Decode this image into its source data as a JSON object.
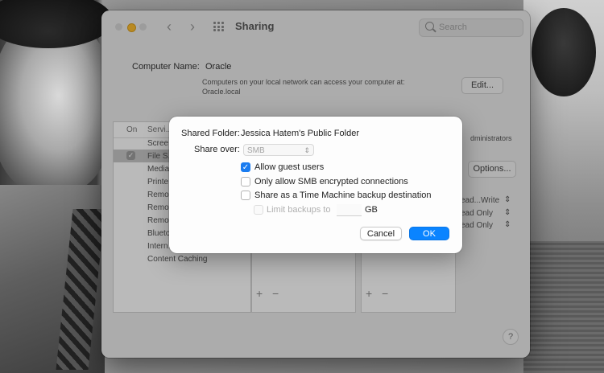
{
  "window": {
    "title": "Sharing",
    "search_placeholder": "Search"
  },
  "background_settings": {
    "computer_name_label": "Computer Name:",
    "computer_name": "Oracle",
    "network_note_line1": "Computers on your local network can access your computer at:",
    "network_note_line2": "Oracle.local",
    "edit_label": "Edit...",
    "services_header_on": "On",
    "services_header_service": "Servi...",
    "services": [
      "Scree...",
      "File S...",
      "Media...",
      "Printe...",
      "Remo...",
      "Remo...",
      "Remo...",
      "Blueto...",
      "Intern...",
      "Content Caching"
    ],
    "users_header_hint": "dministrators",
    "options_label": "Options...",
    "permissions": [
      "ead...Write",
      "ead Only",
      "ead Only"
    ],
    "plus_label": "+",
    "minus_label": "−",
    "help_label": "?"
  },
  "dialog": {
    "shared_folder_label": "Shared Folder:",
    "shared_folder_name": "Jessica Hatem's Public Folder",
    "share_over_label": "Share over:",
    "share_over_value": "SMB",
    "options": [
      {
        "label": "Allow guest users",
        "checked": true
      },
      {
        "label": "Only allow SMB encrypted connections",
        "checked": false
      },
      {
        "label": "Share as a Time Machine backup destination",
        "checked": false
      }
    ],
    "limit_label": "Limit backups to",
    "limit_value": "",
    "limit_unit": "GB",
    "cancel_label": "Cancel",
    "ok_label": "OK"
  }
}
